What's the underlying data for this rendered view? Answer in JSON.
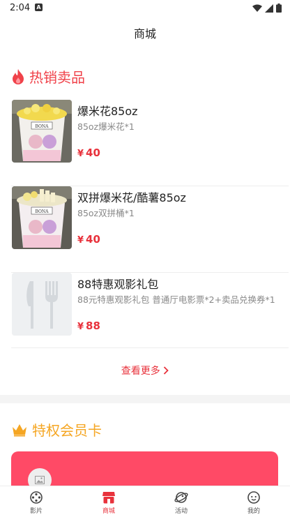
{
  "status_bar": {
    "time": "2:04"
  },
  "nav": {
    "title": "商城"
  },
  "hot_section": {
    "title": "热销卖品",
    "color": "#f0424a"
  },
  "products": [
    {
      "name": "爆米花85oz",
      "desc": "85oz爆米花*1",
      "price_symbol": "¥",
      "price": "40",
      "image": "popcorn-bucket-image"
    },
    {
      "name": "双拼爆米花/酷薯85oz",
      "desc": "85oz双拼桶*1",
      "price_symbol": "¥",
      "price": "40",
      "image": "fries-popcorn-bucket-image"
    },
    {
      "name": "88特惠观影礼包",
      "desc": "88元特惠观影礼包 普通厅电影票*2+卖品兑换券*1",
      "price_symbol": "¥",
      "price": "88",
      "image": "fork-knife-placeholder-icon"
    }
  ],
  "see_more": {
    "label": "查看更多"
  },
  "vip_section": {
    "title": "特权会员卡",
    "color": "#f5a623"
  },
  "tabs": [
    {
      "label": "影片",
      "icon": "film-reel-icon",
      "active": false
    },
    {
      "label": "商城",
      "icon": "shop-icon",
      "active": true
    },
    {
      "label": "活动",
      "icon": "activity-icon",
      "active": false
    },
    {
      "label": "我的",
      "icon": "profile-icon",
      "active": false
    }
  ],
  "colors": {
    "accent": "#e8323c",
    "card": "#ff4a66"
  }
}
